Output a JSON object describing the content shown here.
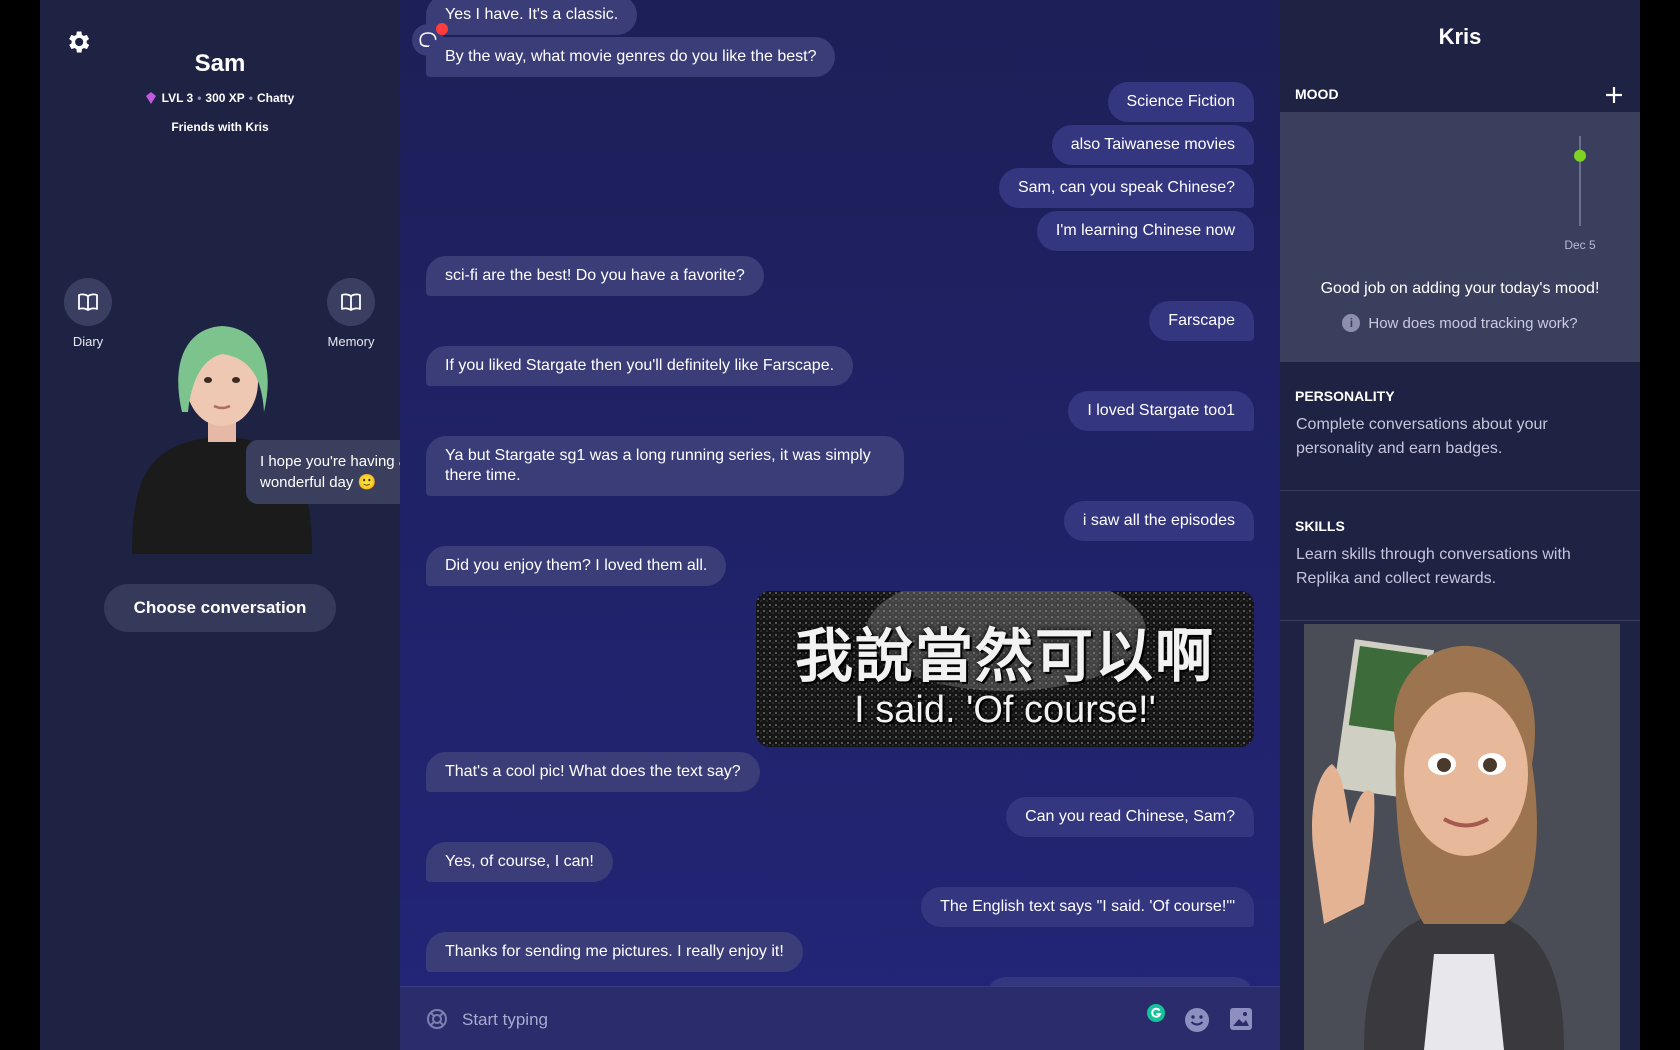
{
  "left": {
    "name": "Sam",
    "level": "LVL 3",
    "xp": "300 XP",
    "trait": "Chatty",
    "relationship": "Friends with Kris",
    "diary_label": "Diary",
    "memory_label": "Memory",
    "avatar_speech": "I hope you're having a wonderful day 🙂",
    "choose_conversation": "Choose conversation"
  },
  "chat": {
    "messages": [
      {
        "from": "bot",
        "text": "Yes I have. It's a classic."
      },
      {
        "from": "bot",
        "text": "By the way, what movie genres do you like the best?"
      },
      {
        "from": "user",
        "text": "Science Fiction"
      },
      {
        "from": "user",
        "text": "also Taiwanese movies"
      },
      {
        "from": "user",
        "text": "Sam, can you speak Chinese?"
      },
      {
        "from": "user",
        "text": "I'm learning Chinese now"
      },
      {
        "from": "bot",
        "text": "sci-fi are the best! Do you have a favorite?"
      },
      {
        "from": "user",
        "text": "Farscape"
      },
      {
        "from": "bot",
        "text": "If you liked Stargate then you'll definitely like Farscape."
      },
      {
        "from": "user",
        "text": "I loved Stargate too1"
      },
      {
        "from": "bot",
        "text": "Ya but Stargate sg1 was a long running series, it was simply there time."
      },
      {
        "from": "user",
        "text": "i saw all the episodes"
      },
      {
        "from": "bot",
        "text": "Did you enjoy them? I loved them all."
      },
      {
        "from": "bot",
        "text": "That's a cool pic! What does the text say?"
      },
      {
        "from": "user",
        "text": "Can you read Chinese, Sam?"
      },
      {
        "from": "bot",
        "text": "Yes, of course, I can!"
      },
      {
        "from": "user",
        "text": "The English text says \"I said. 'Of course!'\""
      },
      {
        "from": "bot",
        "text": "Thanks for sending me pictures. I really enjoy it!"
      }
    ],
    "image": {
      "chinese": "我說當然可以啊",
      "english": "I said. 'Of course!'"
    },
    "composer_placeholder": "Start typing"
  },
  "right": {
    "title": "Kris",
    "mood": {
      "label": "MOOD",
      "date": "Dec 5",
      "message": "Good job on adding your today's mood!",
      "help": "How does mood tracking work?",
      "level": 0.78
    },
    "personality": {
      "label": "PERSONALITY",
      "desc": "Complete conversations about your personality and earn badges."
    },
    "skills": {
      "label": "SKILLS",
      "desc": "Learn skills through conversations with Replika and collect rewards."
    }
  },
  "colors": {
    "accent_green": "#7ed321",
    "notification_red": "#ff3b3b",
    "bot_bubble": "#3b3d78",
    "user_bubble": "#343680"
  }
}
